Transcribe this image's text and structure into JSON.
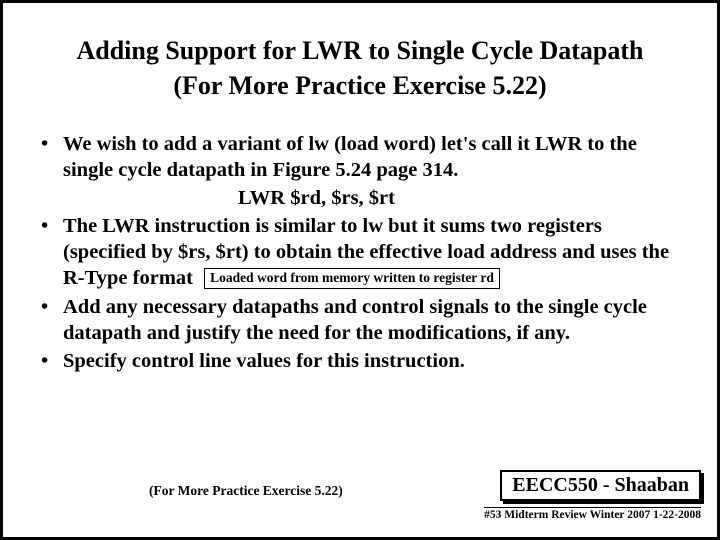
{
  "title_line1": "Adding Support for LWR to Single Cycle Datapath",
  "title_line2": "(For More Practice Exercise 5.22)",
  "bullets": {
    "b1": "We wish to add  a variant of lw (load word)  let's call it LWR to the single cycle datapath in Figure 5.24 page 314.",
    "syntax": "LWR   $rd, $rs,  $rt",
    "b2": "The LWR instruction is similar to lw but it sums two registers (specified by $rs, $rt) to obtain the effective load address and uses the R-Type format",
    "b2_box": "Loaded word from memory written to register rd",
    "b3": "Add any necessary datapaths and control signals to the single cycle datapath and justify the need for the modifications, if any.",
    "b4": "Specify control line values for this instruction."
  },
  "footer_note": "(For More Practice Exercise 5.22)",
  "course": "EECC550 - Shaaban",
  "slidenum": "#53   Midterm Review  Winter 2007  1-22-2008"
}
